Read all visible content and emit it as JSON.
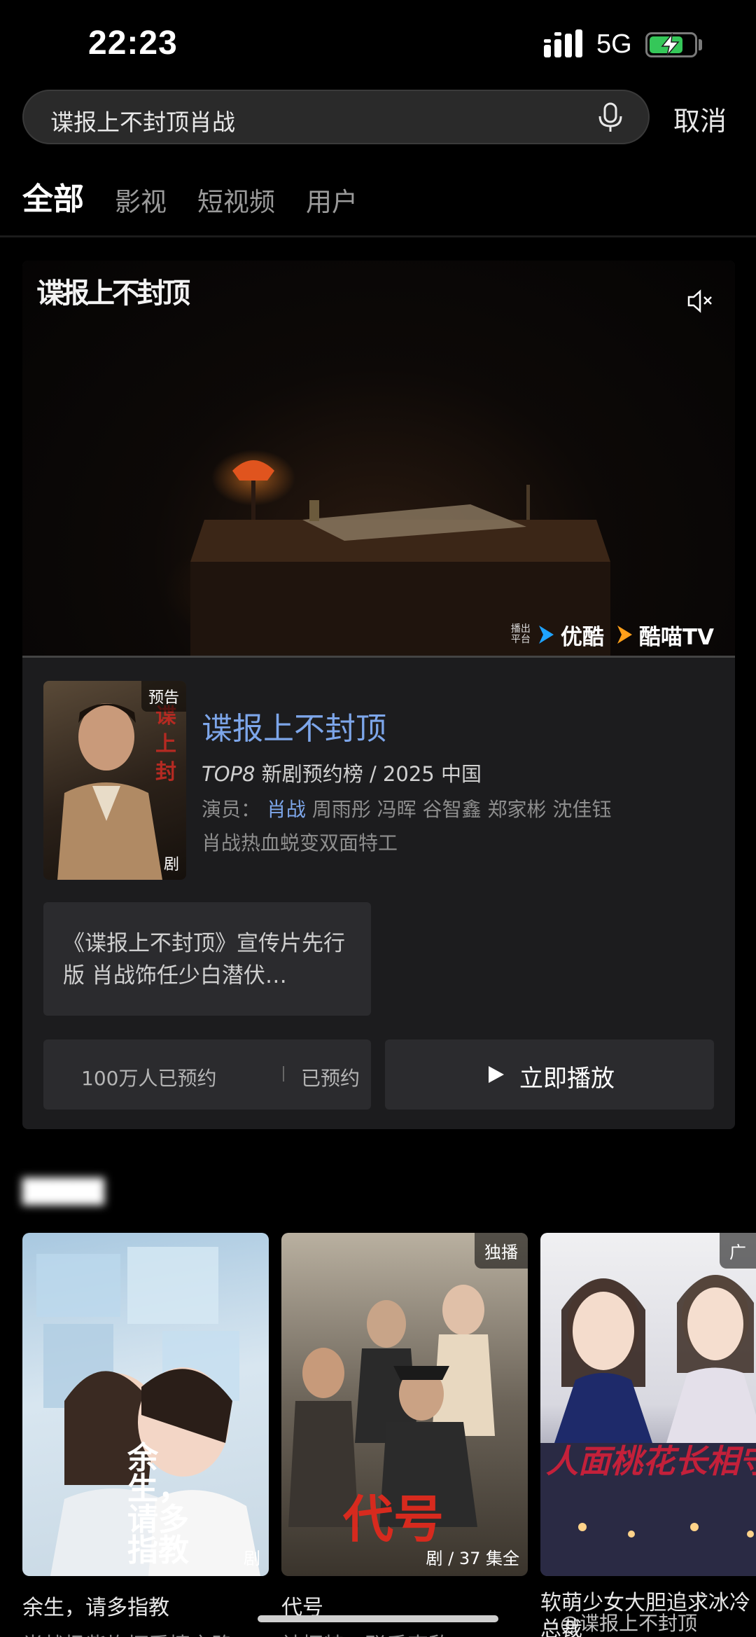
{
  "status_bar": {
    "time": "22:23",
    "network": "5G",
    "battery_level": 0.75,
    "battery_color": "#35c759"
  },
  "search": {
    "query": "谍报上不封顶肖战",
    "icon": "mic-icon",
    "cancel_label": "取消"
  },
  "tabs": [
    {
      "label": "全部",
      "active": true
    },
    {
      "label": "影视",
      "active": false
    },
    {
      "label": "短视频",
      "active": false
    },
    {
      "label": "用户",
      "active": false
    }
  ],
  "hero": {
    "video_logo": "谍报上不封顶",
    "mute_icon": "speaker-muted-icon",
    "platform_caption": "播出平台",
    "platforms": [
      "优酷",
      "酷喵TV"
    ],
    "poster_badge": "预告",
    "poster_tag": "剧",
    "title": "谍报上不封顶",
    "rank": "TOP8",
    "rank_list": "新剧预约榜",
    "meta_rest": "/ 2025 中国",
    "cast_label": "演员：",
    "cast_lead": "肖战",
    "cast_others": "周雨彤 冯晖 谷智鑫 郑家彬 沈佳钰",
    "description": "肖战热血蜕变双面特工",
    "trailer_text": "《谍报上不封顶》宣传片先行版 肖战饰任少白潜伏…",
    "reserve_count": "100万人已预约",
    "reserve_state": "已预约",
    "play_label": "立即播放",
    "accent_color": "#7da6ea"
  },
  "related": {
    "items": [
      {
        "title": "余生，请多指教",
        "subtitle": "肖战杨紫坎坷爱情之路",
        "badge": "",
        "tag": "剧",
        "art_text": "余生，请多指教"
      },
      {
        "title": "代号",
        "subtitle": "神探特工联手克敌",
        "badge": "独播",
        "tag": "剧 / 37 集全",
        "art_text": "代号"
      },
      {
        "title": "软萌少女大胆追求冰冷总裁",
        "subtitle": "",
        "badge": "广",
        "tag": "",
        "art_text": "人面桃花长相守"
      }
    ]
  },
  "watermark": "@谍报上不封顶"
}
